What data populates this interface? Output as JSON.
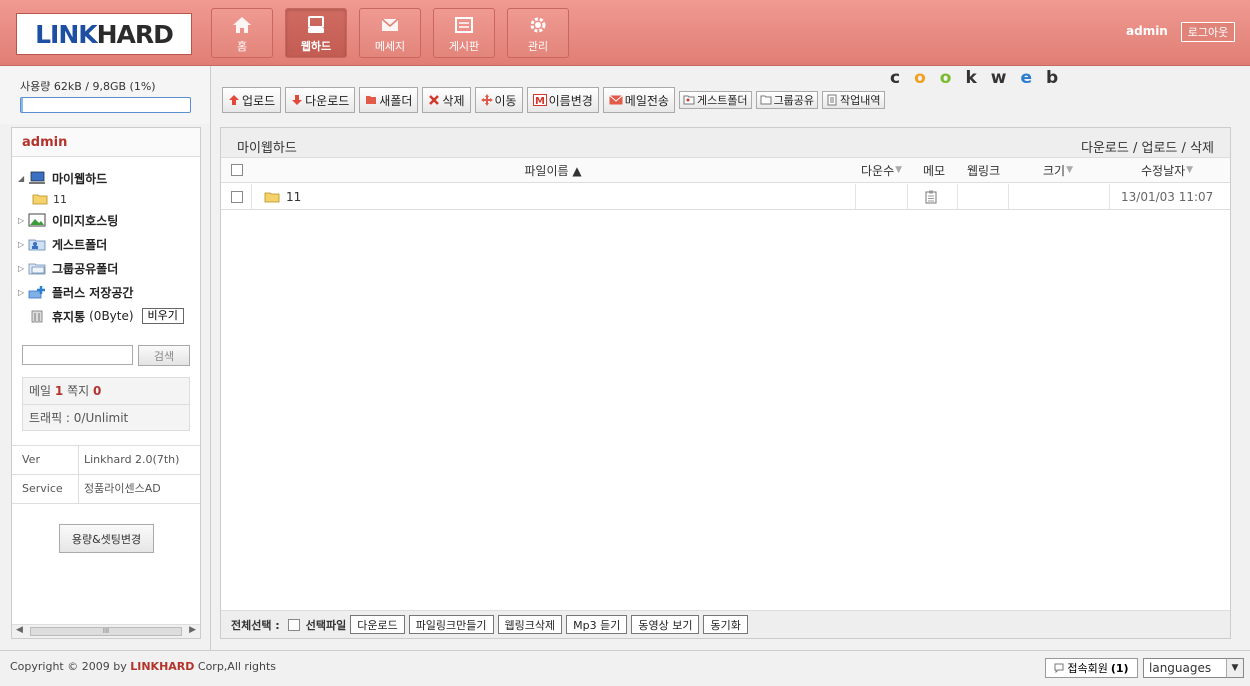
{
  "header": {
    "logo_left": "LINK",
    "logo_right": "HARD",
    "nav": [
      {
        "label": "홈",
        "icon": "home-icon"
      },
      {
        "label": "웹하드",
        "icon": "webhard-icon",
        "active": true
      },
      {
        "label": "메세지",
        "icon": "message-icon"
      },
      {
        "label": "게시판",
        "icon": "board-icon"
      },
      {
        "label": "관리",
        "icon": "gear-icon"
      }
    ],
    "user": "admin",
    "logout_label": "로그아웃"
  },
  "usage": {
    "text": "사용량 62kB / 9,8GB (1%)",
    "percent": 1
  },
  "sidebar": {
    "user": "admin",
    "tree": {
      "root_label": "마이웹하드",
      "root_child": "11",
      "items": [
        {
          "label": "이미지호스팅",
          "icon": "image-hosting-icon"
        },
        {
          "label": "게스트폴더",
          "icon": "guest-folder-icon"
        },
        {
          "label": "그룹공유폴더",
          "icon": "group-folder-icon"
        },
        {
          "label": "플러스 저장공간",
          "icon": "plus-storage-icon"
        }
      ],
      "trash_label": "휴지통",
      "trash_size": "(0Byte)",
      "empty_label": "비우기"
    },
    "search_button": "검색",
    "mail_label": "메일",
    "mail_count": "1",
    "note_label": "쪽지",
    "note_count": "0",
    "traffic": "트래픽 : 0/Unlimit",
    "info": [
      {
        "key": "Ver",
        "value": "Linkhard 2.0(7th)"
      },
      {
        "key": "Service",
        "value": "정품라이센스AD"
      }
    ],
    "settings_button": "용량&셋팅변경",
    "scroll_thumb": "III"
  },
  "toolbar": {
    "upload": "업로드",
    "download": "다운로드",
    "new_folder": "새폴더",
    "delete": "삭제",
    "move": "이동",
    "rename": "이름변경",
    "email": "메일전송",
    "guest_folder": "게스트폴더",
    "group_share": "그룹공유",
    "work_history": "작업내역"
  },
  "cookweb": {
    "c": "c",
    "o1": "o",
    "o2": "o",
    "k": "k",
    "w": "w",
    "e": "e",
    "b": "b"
  },
  "file_panel": {
    "title": "마이웹하드",
    "actions": [
      "다운로드",
      "업로드",
      "삭제"
    ],
    "separator": "/",
    "columns": {
      "name": "파일이름 ▲",
      "downloads": "다운수",
      "memo": "메모",
      "weblink": "웹링크",
      "size": "크기",
      "modified": "수정날자"
    },
    "rows": [
      {
        "name": "11",
        "downloads": "",
        "size": "",
        "modified": "13/01/03 11:07"
      }
    ],
    "footer": {
      "select_all": "전체선택 :",
      "selected_files": "선택파일",
      "buttons": [
        "다운로드",
        "파일링크만들기",
        "웹링크삭제",
        "Mp3 듣기",
        "동영상 보기",
        "동기화"
      ]
    }
  },
  "footer": {
    "copyright_pre": "Copyright © 2009 by",
    "brand": "LINKHARD",
    "copyright_post": "Corp,All rights",
    "online_label": "접속회원",
    "online_count": "(1)",
    "language": "languages"
  }
}
